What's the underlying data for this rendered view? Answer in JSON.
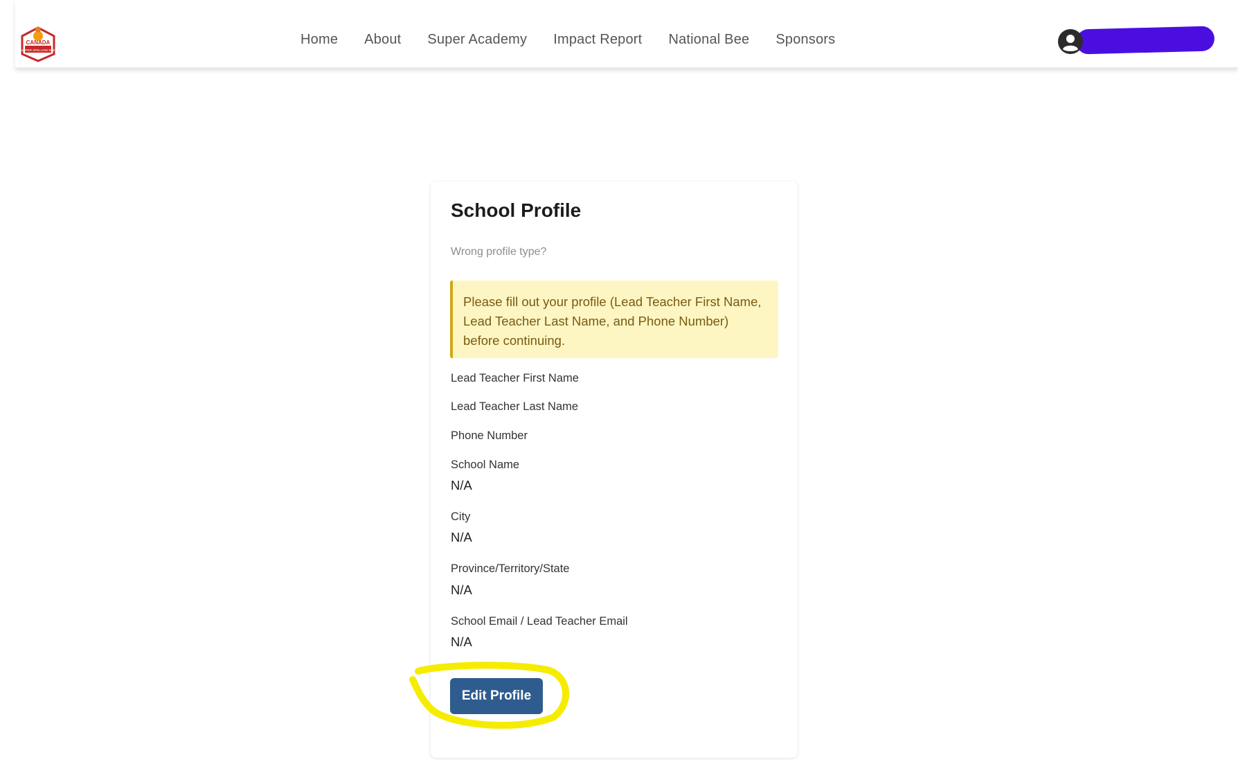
{
  "header": {
    "logo_alt": "Canada Super Spelling Bee logo",
    "nav": [
      {
        "label": "Home"
      },
      {
        "label": "About"
      },
      {
        "label": "Super Academy"
      },
      {
        "label": "Impact Report"
      },
      {
        "label": "National Bee"
      },
      {
        "label": "Sponsors"
      }
    ],
    "user_icon": "user-circle-icon",
    "username_redacted": true,
    "redaction_color": "#4a0fe0"
  },
  "card": {
    "title": "School Profile",
    "wrong_profile_link": "Wrong profile type?",
    "alert_text": "Please fill out your profile (Lead Teacher First Name, Lead Teacher Last Name, and Phone Number) before continuing.",
    "fields": {
      "lead_first": {
        "label": "Lead Teacher First Name",
        "value": ""
      },
      "lead_last": {
        "label": "Lead Teacher Last Name",
        "value": ""
      },
      "phone": {
        "label": "Phone Number",
        "value": ""
      },
      "school_name": {
        "label": "School Name",
        "value": "N/A"
      },
      "city": {
        "label": "City",
        "value": "N/A"
      },
      "province": {
        "label": "Province/Territory/State",
        "value": "N/A"
      },
      "email": {
        "label": "School Email / Lead Teacher Email",
        "value": "N/A"
      }
    },
    "edit_button": "Edit Profile"
  },
  "colors": {
    "button": "#2f5c8f",
    "alert_bg": "#fdf6c3",
    "alert_border": "#d4a514",
    "highlight_marker": "#f5ec00"
  }
}
